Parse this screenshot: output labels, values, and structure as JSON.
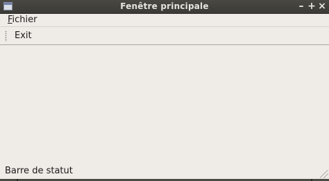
{
  "window": {
    "title": "Fenêtre principale",
    "controls": {
      "minimize_icon": "minimize-icon",
      "minimize_glyph": "–",
      "maximize_icon": "maximize-icon",
      "maximize_glyph": "+",
      "close_icon": "close-icon",
      "close_glyph": "×"
    }
  },
  "menubar": {
    "items": [
      {
        "label": "Fichier",
        "mnemonic": "F",
        "rest": "ichier"
      }
    ]
  },
  "toolbar": {
    "exit_label": "Exit"
  },
  "statusbar": {
    "text": "Barre de statut"
  },
  "colors": {
    "titlebar": "#3b3a36",
    "title_text": "#e6e4df",
    "window_bg": "#efebe7",
    "text": "#1b1b1b"
  }
}
